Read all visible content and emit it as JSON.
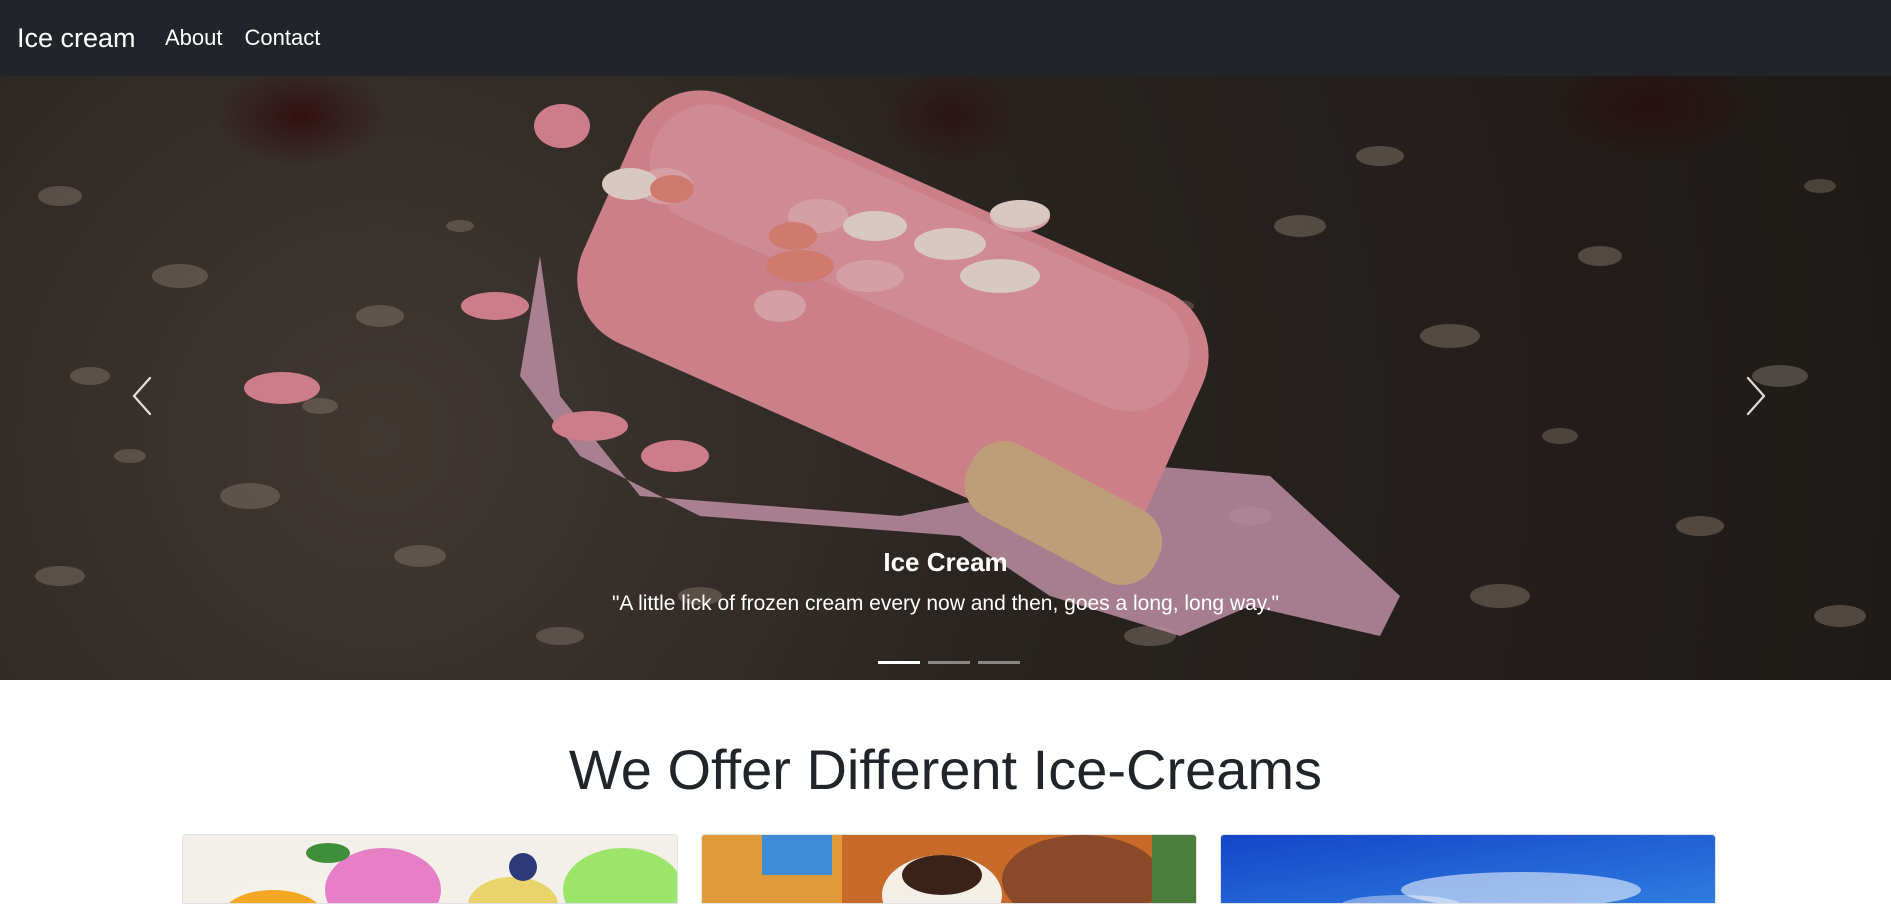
{
  "navbar": {
    "brand": "Ice cream",
    "links": [
      {
        "label": "About"
      },
      {
        "label": "Contact"
      }
    ]
  },
  "carousel": {
    "slides_count": 3,
    "active_index": 0,
    "caption": {
      "title": "Ice Cream",
      "text": "\"A little lick of frozen cream every now and then, goes a long, long way.\""
    },
    "prev_icon": "chevron-left-icon",
    "next_icon": "chevron-right-icon"
  },
  "section": {
    "title": "We Offer Different Ice-Creams"
  },
  "colors": {
    "navbar_bg": "#212529",
    "text": "#212529",
    "popsicle": "#e8919a"
  }
}
